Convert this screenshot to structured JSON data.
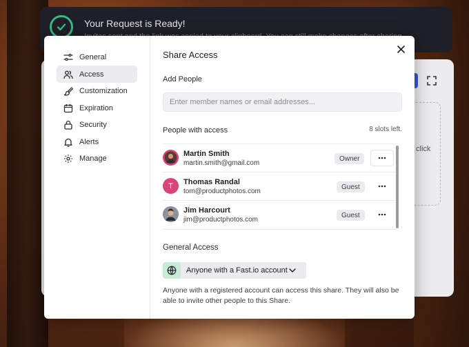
{
  "notification": {
    "title": "Your Request is Ready!",
    "message": "Invites sent and the link was copied to your clipboard. You can still make changes after sharing."
  },
  "background_card": {
    "click_text": "click"
  },
  "sidebar": {
    "items": [
      {
        "label": "General",
        "icon": "sliders-icon"
      },
      {
        "label": "Access",
        "icon": "users-icon",
        "active": true
      },
      {
        "label": "Customization",
        "icon": "brush-icon"
      },
      {
        "label": "Expiration",
        "icon": "calendar-icon"
      },
      {
        "label": "Security",
        "icon": "lock-icon"
      },
      {
        "label": "Alerts",
        "icon": "bell-icon"
      },
      {
        "label": "Manage",
        "icon": "gear-icon"
      }
    ]
  },
  "main": {
    "title": "Share Access",
    "add_people_label": "Add People",
    "add_people_placeholder": "Enter member names or email addresses...",
    "people_label": "People with access",
    "slots_left": "8 slots left.",
    "people": [
      {
        "name": "Martin Smith",
        "email": "martin.smith@gmail.com",
        "role": "Owner",
        "avatar": "photo"
      },
      {
        "name": "Thomas Randal",
        "email": "tom@productphotos.com",
        "role": "Guest",
        "avatar": "T"
      },
      {
        "name": "Jim Harcourt",
        "email": "jim@productphotos.com",
        "role": "Guest",
        "avatar": "photo"
      }
    ],
    "general_access_label": "General Access",
    "general_access_value": "Anyone with a Fast.io account",
    "general_access_description": "Anyone with a registered account can access this share. They will also be able to invite other people to this Share."
  },
  "colors": {
    "accent_green": "#3bb58a",
    "avatar_pink": "#d8457a",
    "primary_blue": "#2f5ae0"
  }
}
